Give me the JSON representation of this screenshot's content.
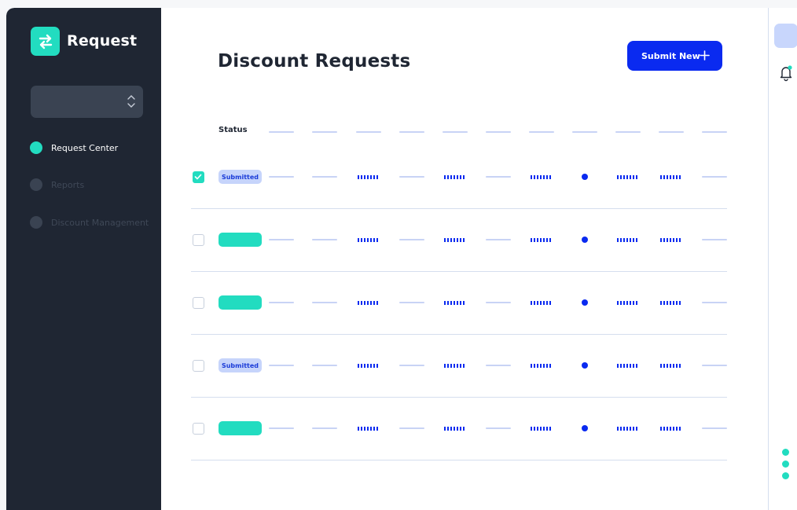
{
  "app": {
    "title": "Request",
    "logo_icon": "swap-arrows-icon",
    "accent_color": "#22dcc0",
    "primary_color": "#0a2af0",
    "sidebar_color": "#1f2633"
  },
  "sidebar": {
    "selector": {
      "value": "",
      "icon": "chevron-up-down-icon"
    },
    "items": [
      {
        "label": "Request Center",
        "active": true
      },
      {
        "label": "Reports",
        "active": false
      },
      {
        "label": "Discount Management",
        "active": false
      }
    ]
  },
  "main": {
    "title": "Discount Requests",
    "submit_button": {
      "label": "Submit New",
      "icon": "plus-icon"
    },
    "table": {
      "status_header": "Status",
      "rows": [
        {
          "checked": true,
          "status": "Submitted"
        },
        {
          "checked": false,
          "status": ""
        },
        {
          "checked": false,
          "status": ""
        },
        {
          "checked": false,
          "status": "Submitted"
        },
        {
          "checked": false,
          "status": ""
        }
      ]
    }
  },
  "right_rail": {
    "notification_icon": "bell-icon",
    "menu_icon": "vertical-dots-icon"
  }
}
